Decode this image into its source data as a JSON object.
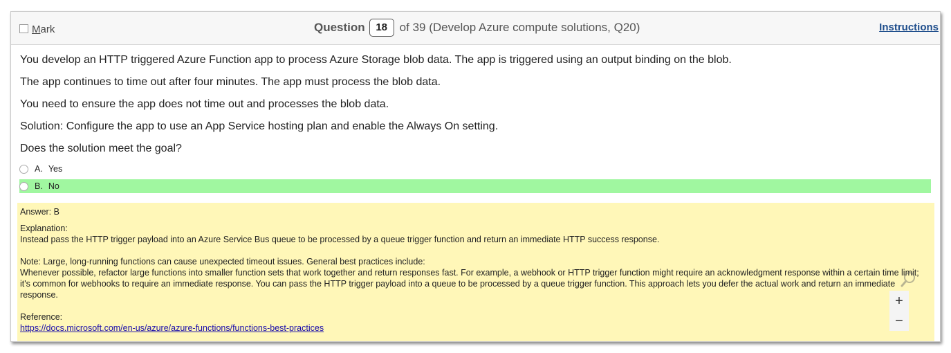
{
  "header": {
    "mark_label": "Mark",
    "question_word": "Question",
    "question_number": "18",
    "question_suffix": "of 39 (Develop Azure compute solutions, Q20)",
    "instructions_label": "Instructions"
  },
  "question": {
    "paragraphs": [
      "You develop an HTTP triggered Azure Function app to process Azure Storage blob data. The app is triggered using an output binding on the blob.",
      "The app continues to time out after four minutes. The app must process the blob data.",
      "You need to ensure the app does not time out and processes the blob data.",
      "Solution: Configure the app to use an App Service hosting plan and enable the Always On setting.",
      "Does the solution meet the goal?"
    ],
    "options": [
      {
        "letter": "A.",
        "text": "Yes",
        "selected": false
      },
      {
        "letter": "B.",
        "text": "No",
        "selected": true
      }
    ]
  },
  "answer": {
    "answer_line": "Answer: B",
    "explanation_label": "Explanation:",
    "explanation_text": "Instead pass the HTTP trigger payload into an Azure Service Bus queue to be processed by a queue trigger function and return an immediate HTTP success response.",
    "note_line": "Note: Large, long-running functions can cause unexpected timeout issues. General best practices include:",
    "note_text": "Whenever possible, refactor large functions into smaller function sets that work together and return responses fast. For example, a webhook or HTTP trigger function might require an acknowledgment response within a certain time limit; it's common for webhooks to require an immediate response. You can pass the HTTP trigger payload into a queue to be processed by a queue trigger function. This approach lets you defer the actual work and return an immediate response.",
    "reference_label": "Reference:",
    "reference_link": "https://docs.microsoft.com/en-us/azure/azure-functions/functions-best-practices"
  },
  "zoom": {
    "zoom_in": "+",
    "zoom_out": "−",
    "search_icon": "magnifier-icon"
  },
  "colors": {
    "selected_option": "#a0f7a0",
    "answer_background": "#fff7b8",
    "link": "#1a0dab"
  }
}
